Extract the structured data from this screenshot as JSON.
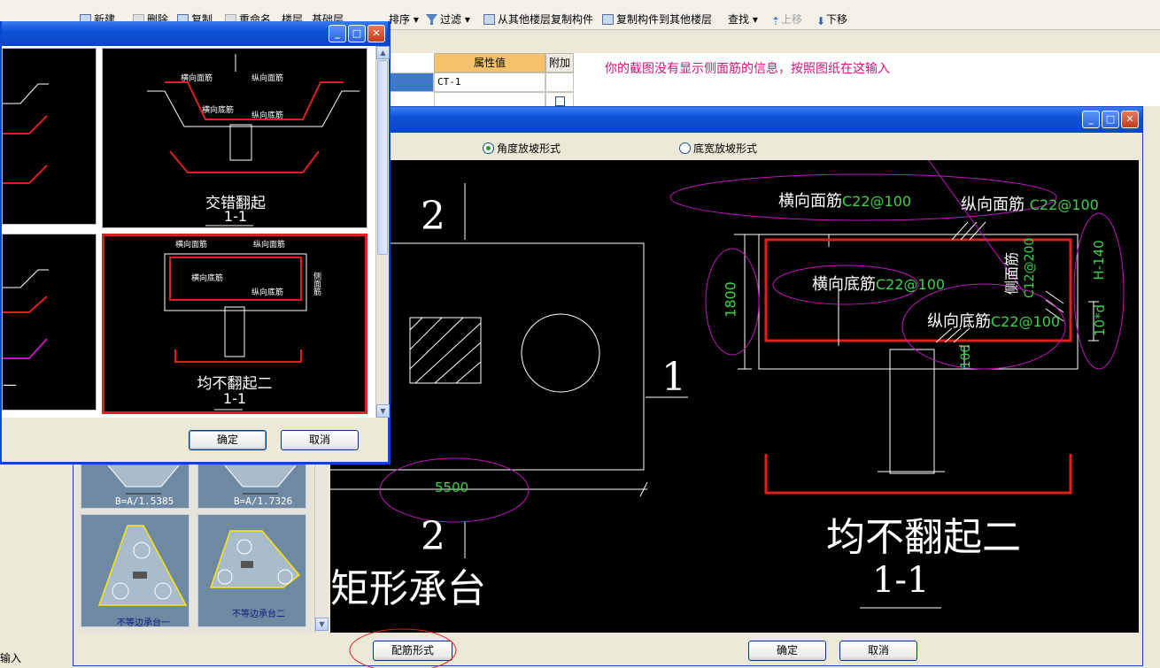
{
  "toolbar": {
    "items": [
      {
        "label": "新建",
        "icon": "new-icon"
      },
      {
        "label": "删除",
        "icon": "delete-icon"
      },
      {
        "label": "复制",
        "icon": "copy-icon"
      },
      {
        "label": "重命名",
        "icon": "rename-icon"
      },
      {
        "label": "楼层",
        "icon": ""
      },
      {
        "label": "基础层",
        "icon": ""
      },
      {
        "label": "排序",
        "icon": "sort-icon"
      },
      {
        "label": "过滤",
        "icon": "filter-icon"
      },
      {
        "label": "从其他楼层复制构件",
        "icon": "copy-from-floor-icon"
      },
      {
        "label": "复制构件到其他楼层",
        "icon": "copy-to-floor-icon"
      },
      {
        "label": "查找",
        "icon": "find-icon"
      },
      {
        "label": "上移",
        "icon": "up-arrow-icon"
      },
      {
        "label": "下移",
        "icon": "down-arrow-icon"
      }
    ]
  },
  "property_grid": {
    "headers": [
      "属性值",
      "附加"
    ],
    "row1_value": "CT-1",
    "header_color": "#f5c26a"
  },
  "annotation_note": "你的截图没有显示侧面筋的信息，按照图纸在这输入",
  "annotation_color": "#d4157a",
  "main_window": {
    "radio_options": [
      {
        "label": "角度放坡形式",
        "checked": true
      },
      {
        "label": "底宽放坡形式",
        "checked": false
      }
    ],
    "cad": {
      "section_mark_top": "2",
      "section_mark_bottom": "2",
      "section_mark_side": "1",
      "dimension_width": "5500",
      "shape_name": "矩形承台",
      "rebar_top_transverse": "横向面筋",
      "rebar_top_transverse_spec": "C22@100",
      "rebar_top_longitudinal": "纵向面筋",
      "rebar_top_longitudinal_spec": "C22@100",
      "rebar_bottom_transverse": "横向底筋",
      "rebar_bottom_transverse_spec": "C22@100",
      "rebar_bottom_longitudinal": "纵向底筋",
      "rebar_bottom_longitudinal_spec": "C22@100",
      "rebar_side": "侧面筋",
      "rebar_side_spec": "C12@200",
      "dim_height": "1800",
      "dim_h_minus": "H-140",
      "dim_10d": "10*d",
      "dim_100": "100",
      "section_title": "均不翻起二",
      "section_label": "1-1"
    },
    "thumbnails": [
      {
        "label": "B=A/1.5385"
      },
      {
        "label": "B=A/1.7326"
      },
      {
        "label": "不等边承台一"
      },
      {
        "label": "不等边承台二"
      }
    ],
    "config_button": "配筋形式",
    "ok_button": "确定",
    "cancel_button": "取消"
  },
  "dialog": {
    "options": [
      {
        "title": "交错翻起",
        "section": "1-1",
        "selected": false
      },
      {
        "title": "均不翻起二",
        "section": "1-1",
        "selected": true
      }
    ],
    "small_labels": {
      "top_transverse": "横向面筋",
      "top_longitudinal": "纵向面筋",
      "bottom_transverse": "横向底筋",
      "bottom_longitudinal": "纵向底筋",
      "side": "侧面筋"
    },
    "ok_button": "确定",
    "cancel_button": "取消"
  },
  "status_bar": {
    "text": "输入"
  }
}
